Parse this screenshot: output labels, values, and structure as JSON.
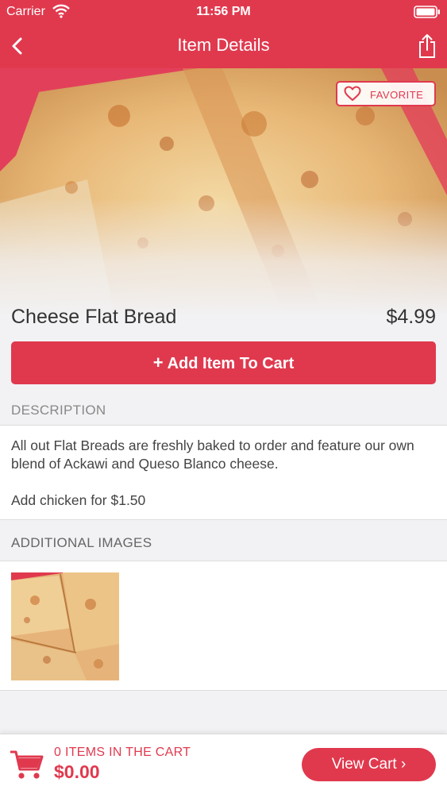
{
  "status_bar": {
    "carrier": "Carrier",
    "time": "11:56 PM"
  },
  "nav": {
    "title": "Item Details",
    "back_icon": "chevron-left-icon",
    "share_icon": "share-icon"
  },
  "favorite": {
    "label": "FAVORITE",
    "icon": "heart-outline-icon"
  },
  "item": {
    "name": "Cheese Flat Bread",
    "price": "$4.99"
  },
  "add_to_cart": {
    "plus": "+",
    "label": "Add Item To Cart"
  },
  "description": {
    "header": "DESCRIPTION",
    "text": "All out Flat Breads are freshly baked to order and feature our own blend of Ackawi and Queso Blanco cheese.",
    "extra": "Add chicken for $1.50"
  },
  "additional_images": {
    "header": "ADDITIONAL IMAGES",
    "count": 1
  },
  "cart": {
    "items_label": "0 ITEMS IN THE CART",
    "total": "$0.00",
    "view_cart": "View Cart ›",
    "icon": "shopping-cart-icon"
  },
  "colors": {
    "brand": "#e0394e",
    "background": "#f2f2f4",
    "text": "#333333"
  }
}
